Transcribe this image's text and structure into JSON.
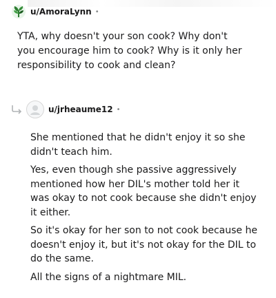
{
  "comment1": {
    "username": "u/AmoraLynn",
    "separator": "•",
    "avatar_icon": "plant-avatar-icon",
    "body": "YTA, why doesn't your son cook? Why don't you encourage him to cook? Why is it only her responsibility to cook and clean?"
  },
  "comment2": {
    "username": "u/jrheaume12",
    "separator": "•",
    "reply_icon": "reply-arrow-icon",
    "avatar_icon": "default-avatar-icon",
    "paragraphs": [
      "She mentioned that he didn't enjoy it so she didn't teach him.",
      "Yes, even though she passive aggressively mentioned how her DIL's mother told her it was okay to not cook because she didn't enjoy it either.",
      "So it's okay for her son to not cook because he doesn't enjoy it, but it's not okay for the DIL to do the same.",
      "All the signs of a nightmare MIL."
    ]
  },
  "colors": {
    "text": "#1a1a1b",
    "meta": "#878a8c",
    "avatar_green": "#2e7d32"
  }
}
